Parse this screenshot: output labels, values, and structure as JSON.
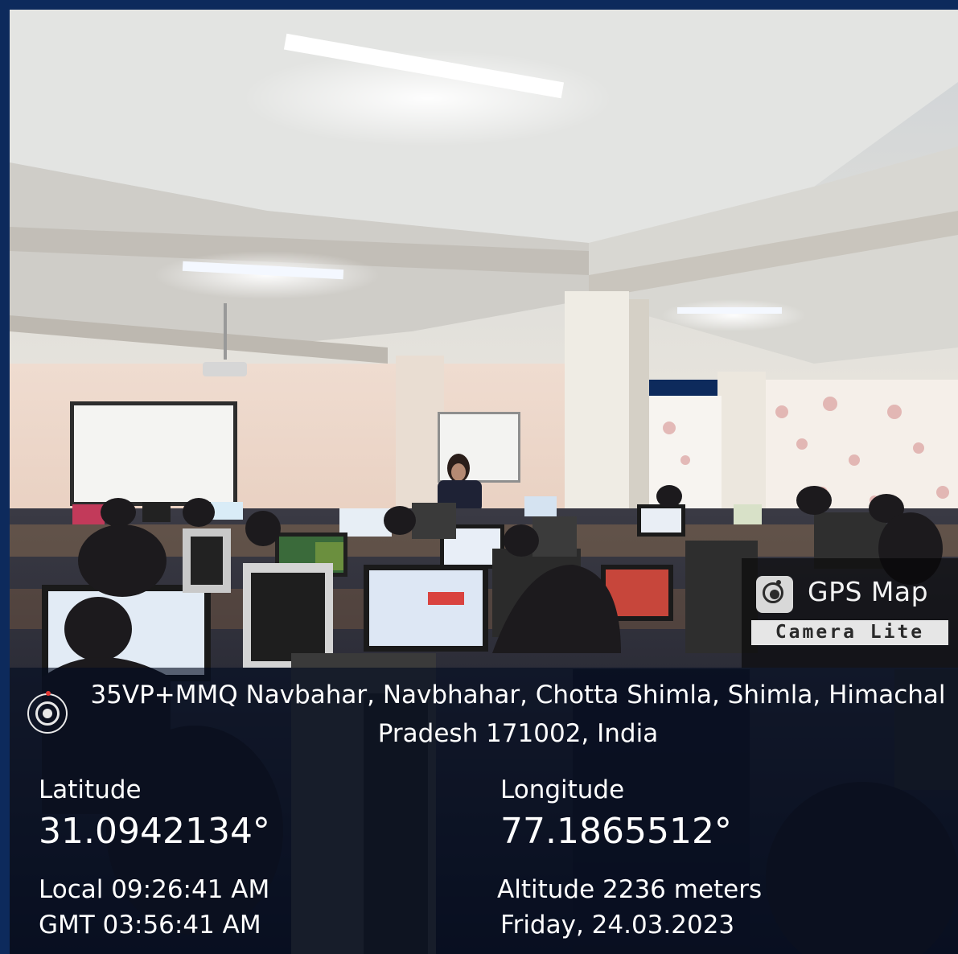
{
  "watermark": {
    "title": "GPS Map",
    "subtitle": "Camera Lite",
    "icon": "camera-lens-icon"
  },
  "location": {
    "icon": "location-lens-icon",
    "address": "35VP+MMQ Navbahar, Navbhahar, Chotta Shimla, Shimla, Himachal Pradesh 171002, India"
  },
  "coordinates": {
    "latitude_label": "Latitude",
    "latitude_value": "31.0942134°",
    "longitude_label": "Longitude",
    "longitude_value": "77.1865512°"
  },
  "time": {
    "local": "Local 09:26:41 AM",
    "gmt": "GMT 03:56:41 AM",
    "altitude": "Altitude 2236 meters",
    "date": "Friday, 24.03.2023"
  },
  "colors": {
    "frame": "#0d2a5c",
    "panel": "#020c20"
  }
}
